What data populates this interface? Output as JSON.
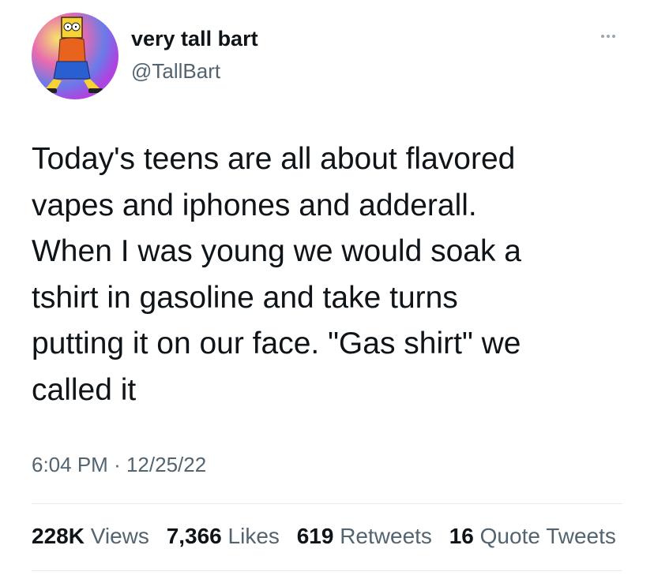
{
  "user": {
    "display_name": "very tall bart",
    "handle": "@TallBart"
  },
  "tweet": {
    "text": "Today's teens are all about flavored\nvapes and iphones and adderall.\nWhen I was young we would soak a\ntshirt in gasoline and take turns\nputting it on our face. \"Gas shirt\" we\ncalled it",
    "time": "6:04 PM",
    "separator": "·",
    "date": "12/25/22"
  },
  "stats": [
    {
      "value": "228K",
      "label": "Views"
    },
    {
      "value": "7,366",
      "label": "Likes"
    },
    {
      "value": "619",
      "label": "Retweets"
    },
    {
      "value": "16",
      "label": "Quote Tweets"
    }
  ],
  "icons": {
    "more": "more-horizontal-icon"
  }
}
